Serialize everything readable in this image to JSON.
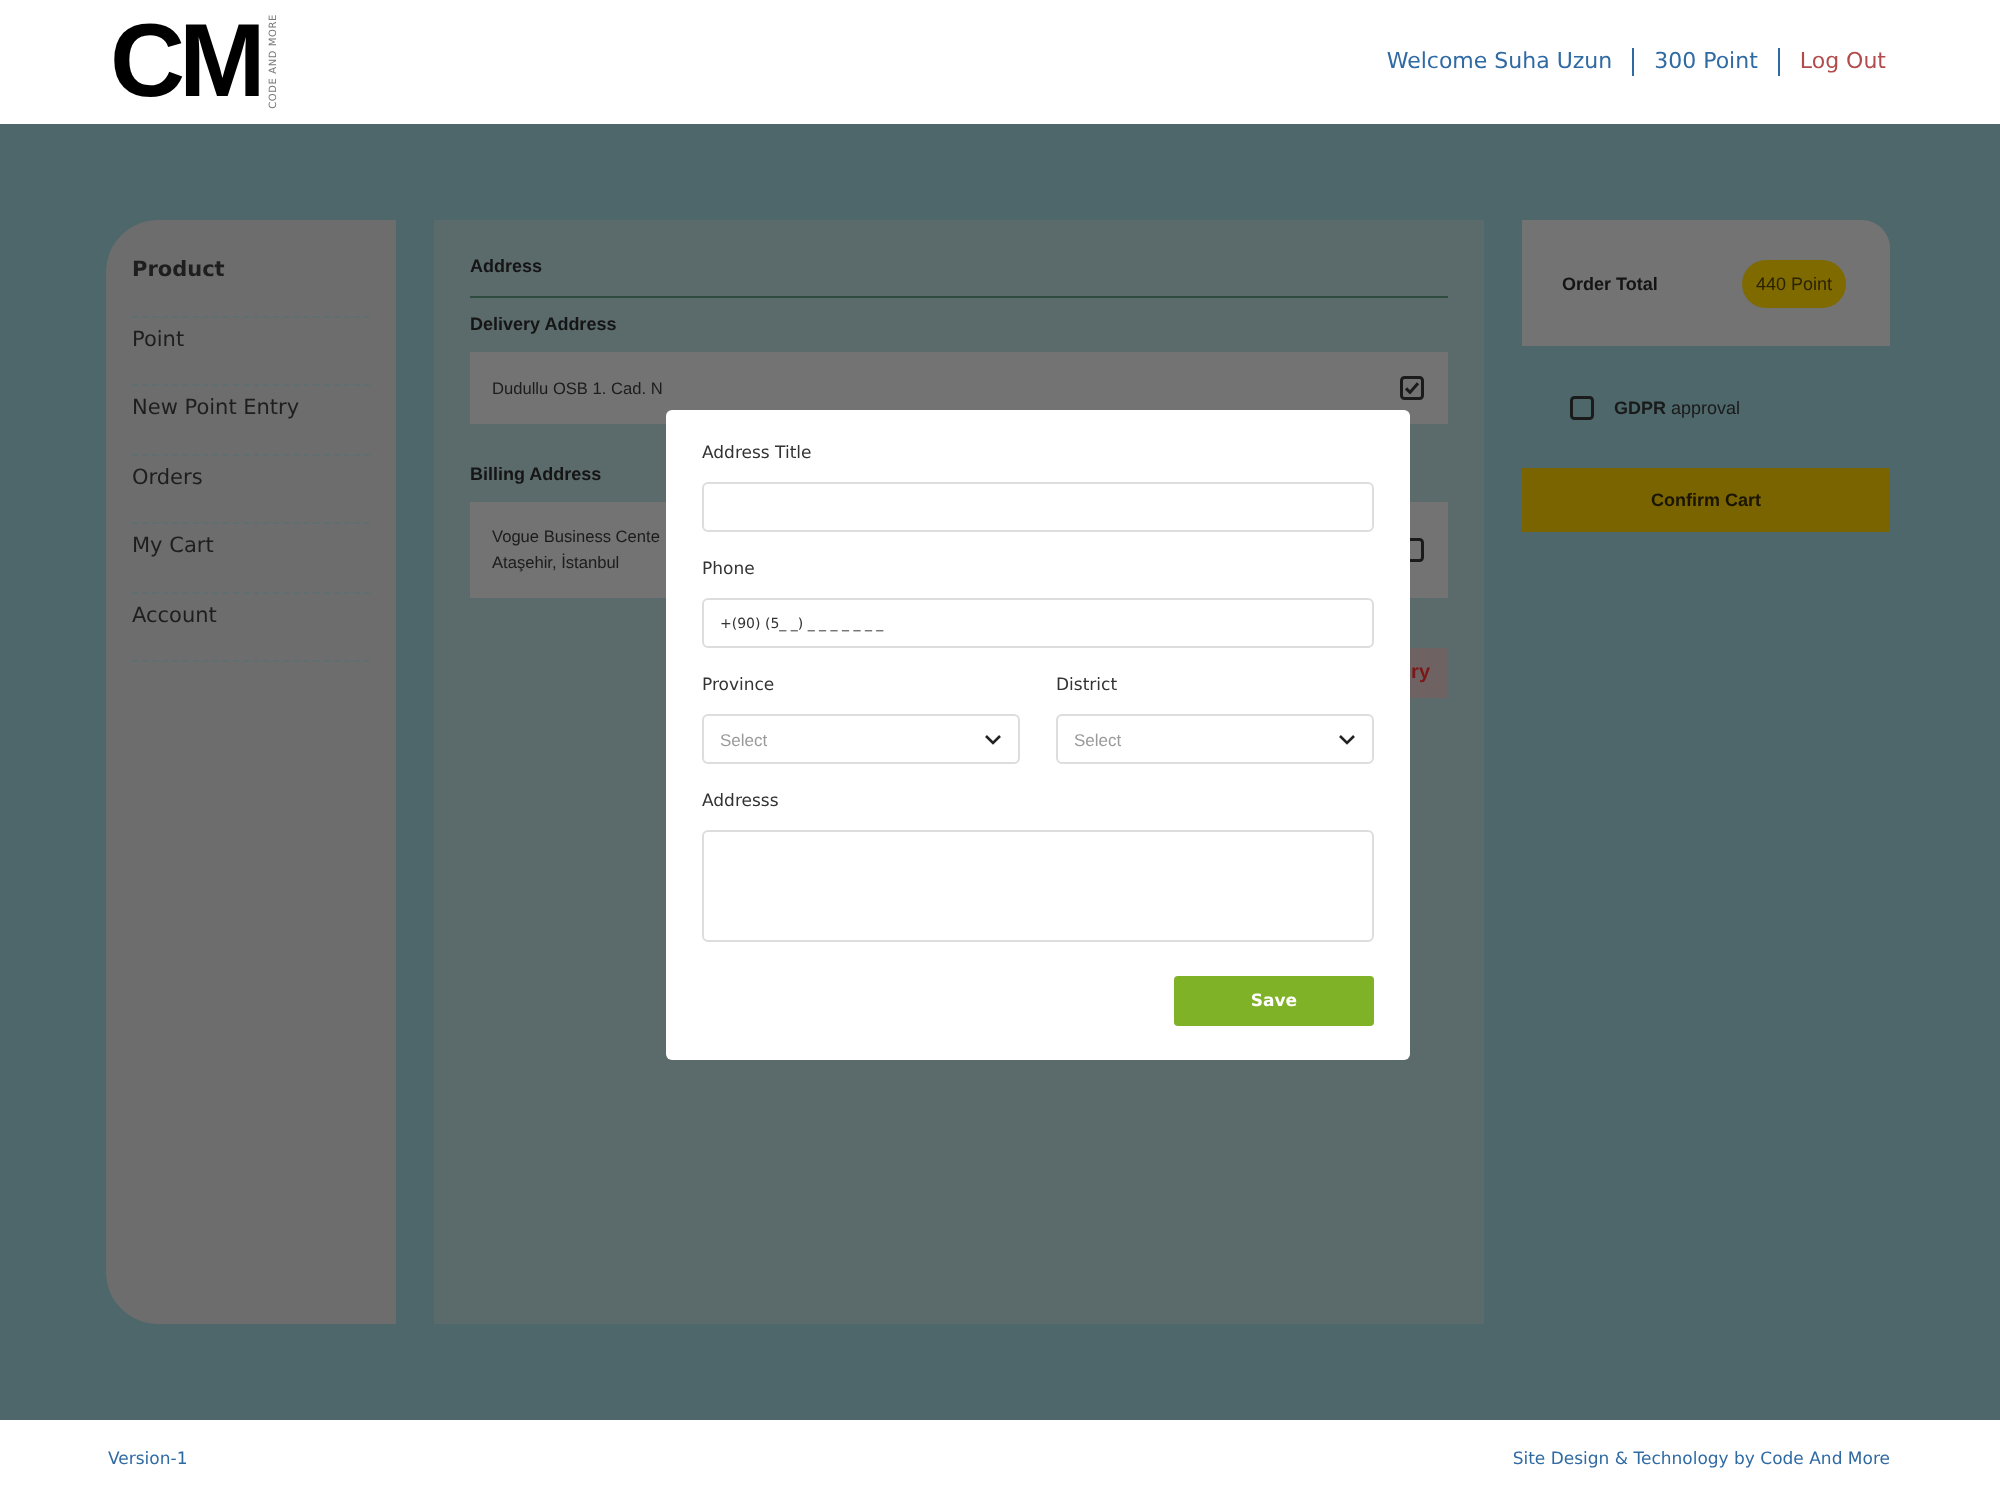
{
  "header": {
    "logo_text": "CM",
    "logo_tagline": "CODE AND MORE",
    "welcome": "Welcome Suha Uzun",
    "points": "300 Point",
    "logout": "Log Out"
  },
  "sidebar": {
    "items": [
      {
        "label": "Product",
        "selected": true
      },
      {
        "label": "Point",
        "selected": false
      },
      {
        "label": "New Point Entry",
        "selected": false
      },
      {
        "label": "Orders",
        "selected": false
      },
      {
        "label": "My Cart",
        "selected": false
      },
      {
        "label": "Account",
        "selected": false
      }
    ]
  },
  "address": {
    "title": "Address",
    "delivery_heading": "Delivery Address",
    "delivery": {
      "lines": [
        "Dudullu OSB 1. Cad. N"
      ],
      "checked": true
    },
    "billing_heading": "Billing Address",
    "billing": {
      "lines": [
        "Vogue Business Cente",
        "Ataşehir, İstanbul"
      ],
      "checked": false
    },
    "add_button": "ry"
  },
  "summary": {
    "label": "Order Total",
    "total": "440 Point",
    "gdpr": {
      "text": "**GDPR** approval",
      "checked": false
    },
    "confirm": "Confirm Cart"
  },
  "modal": {
    "fields": [
      {
        "kind": "text",
        "label": "Address Title"
      },
      {
        "kind": "text",
        "label": "Phone",
        "value": "+(90) (5_ _) _ _ _  _ _  _ _"
      },
      {
        "kind": "select",
        "label": "Province",
        "placeholder": "Select"
      },
      {
        "kind": "select",
        "label": "District",
        "placeholder": "Select"
      },
      {
        "kind": "textarea",
        "label": "Addresss"
      }
    ],
    "save": "Save"
  },
  "footer": {
    "version": "Version-1",
    "credit": "Site Design & Technology by Code And More"
  }
}
